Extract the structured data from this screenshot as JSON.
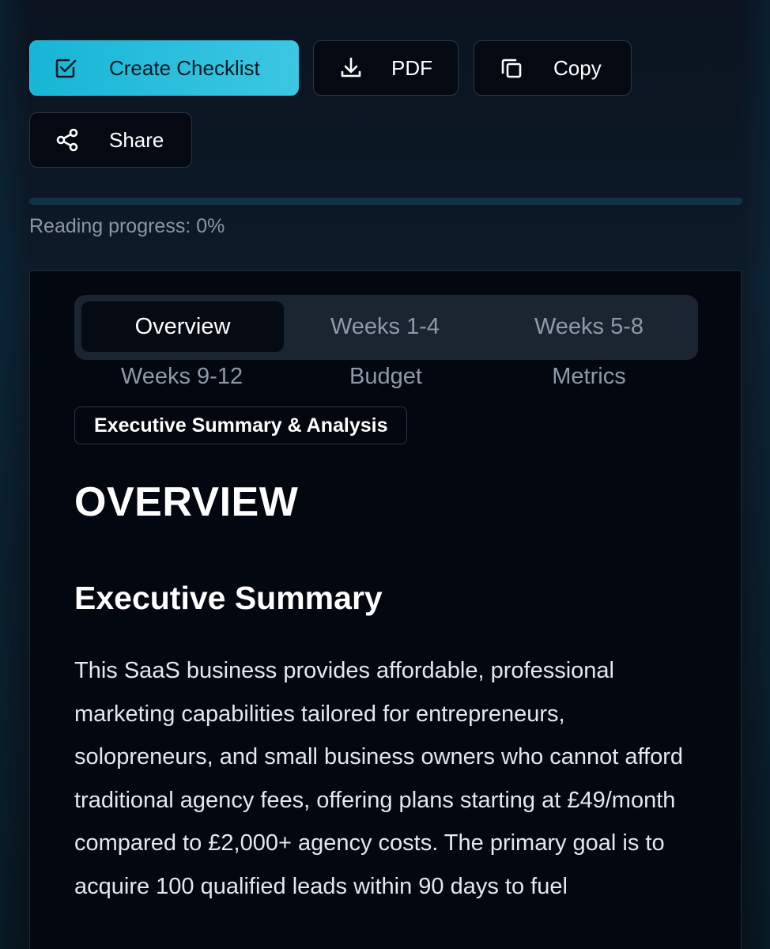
{
  "actions": {
    "create_checklist": "Create Checklist",
    "pdf": "PDF",
    "copy": "Copy",
    "share": "Share"
  },
  "icons": {
    "create_checklist": "checkbox-icon",
    "pdf": "download-icon",
    "copy": "copy-icon",
    "share": "share-icon"
  },
  "progress": {
    "label": "Reading progress: 0%",
    "value": 0
  },
  "tabs": [
    {
      "label": "Overview",
      "active": true
    },
    {
      "label": "Weeks 1-4",
      "active": false
    },
    {
      "label": "Weeks 5-8",
      "active": false
    },
    {
      "label": "Weeks 9-12",
      "active": false
    },
    {
      "label": "Budget",
      "active": false
    },
    {
      "label": "Metrics",
      "active": false
    }
  ],
  "section_chip": "Executive Summary & Analysis",
  "content": {
    "heading": "OVERVIEW",
    "subheading": "Executive Summary",
    "paragraph": "This SaaS business provides affordable, professional marketing capabilities tailored for entrepreneurs, solopreneurs, and small business owners who cannot afford traditional agency fees, offering plans starting at £49/month compared to £2,000+ agency costs. The primary goal is to acquire 100 qualified leads within 90 days to fuel"
  },
  "colors": {
    "accent": "#22b8d8",
    "background": "#0b1522",
    "card": "#03070f"
  }
}
